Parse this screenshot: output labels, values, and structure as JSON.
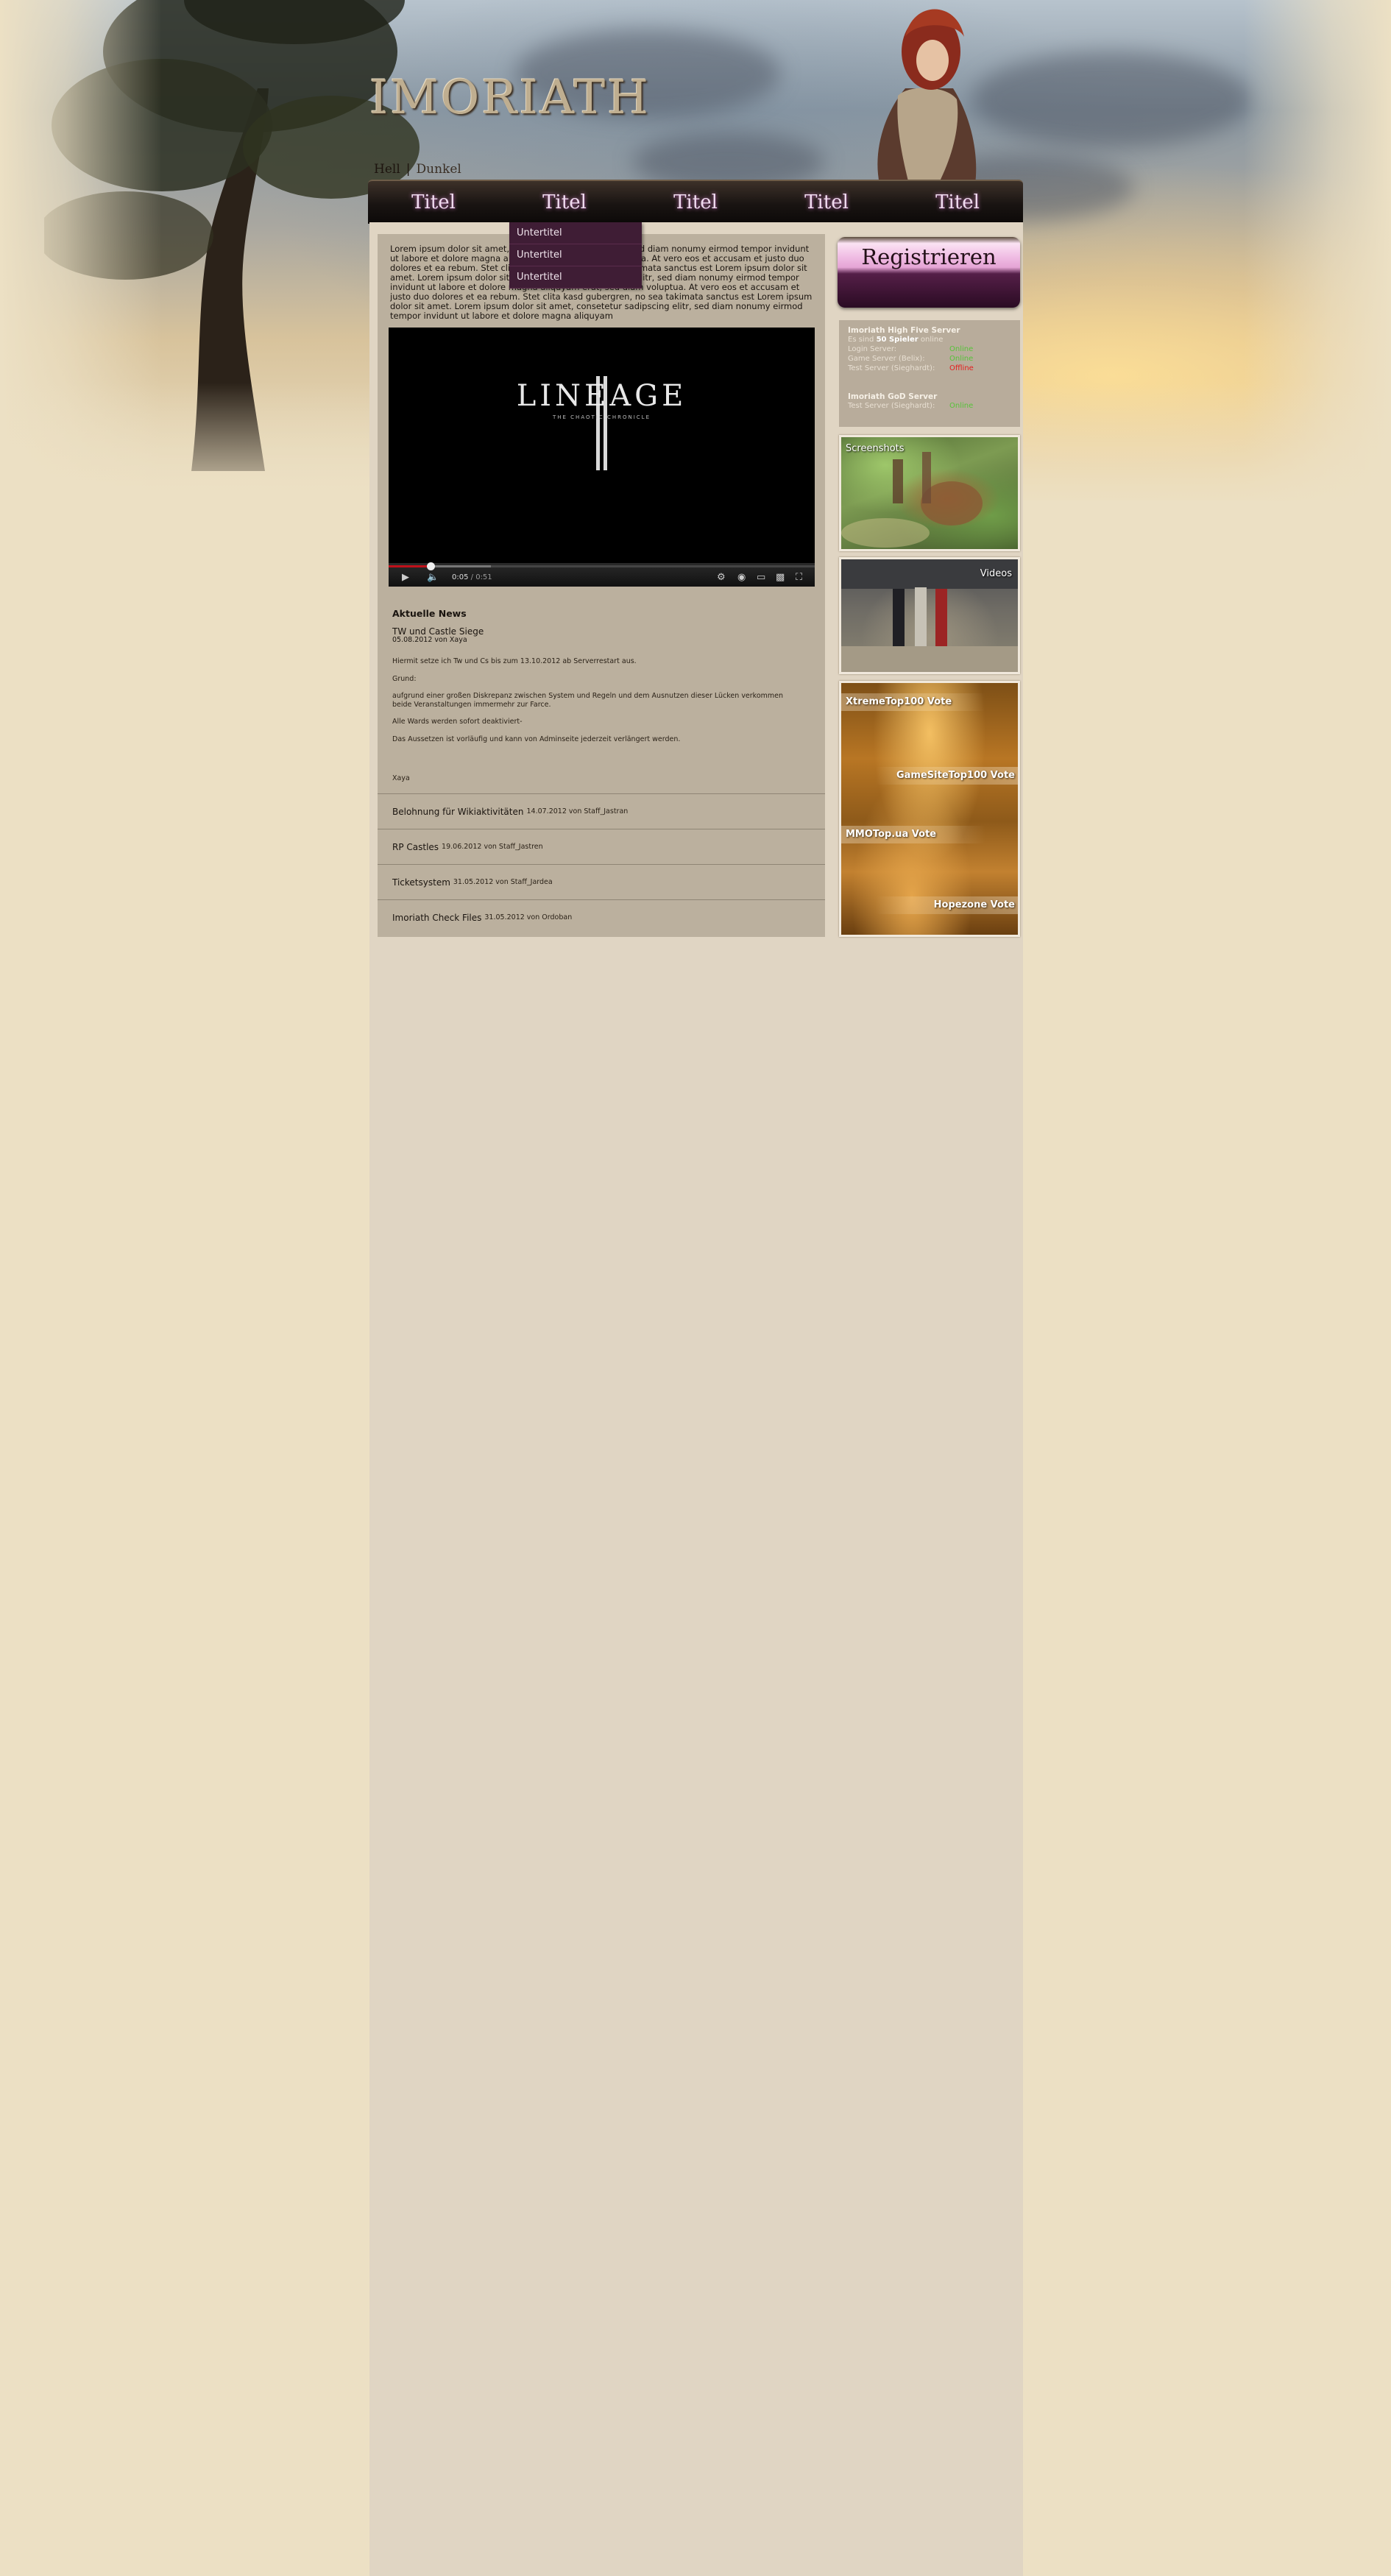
{
  "site": {
    "logo_text": "IMORIATH",
    "styles": {
      "hell": "Hell",
      "separator": "|",
      "dunkel": "Dunkel"
    }
  },
  "nav": {
    "items": [
      "Titel",
      "Titel",
      "Titel",
      "Titel",
      "Titel"
    ],
    "dropdown": [
      "Untertitel",
      "Untertitel",
      "Untertitel"
    ]
  },
  "intro_text": "Lorem ipsum dolor sit amet, consetetur sadipscing elitr, sed diam nonumy eirmod tempor invidunt ut labore et dolore magna aliquyam erat, sed diam voluptua. At vero eos et accusam et justo duo dolores et ea rebum. Stet clita kasd gubergren, no sea takimata sanctus est Lorem ipsum dolor sit amet. Lorem ipsum dolor sit amet, consetetur sadipscing elitr, sed diam nonumy eirmod tempor invidunt ut labore et dolore magna aliquyam erat, sed diam voluptua. At vero eos et accusam et justo duo dolores et ea rebum. Stet clita kasd gubergren, no sea takimata sanctus est Lorem ipsum dolor sit amet. Lorem ipsum dolor sit amet, consetetur sadipscing elitr, sed diam nonumy eirmod tempor invidunt ut labore et dolore magna aliquyam",
  "video": {
    "logo_text": "LINEAGE",
    "logo_subtitle": "THE CHAOTIC CHRONICLE",
    "time_current": "0:05",
    "time_duration": "/ 0:51",
    "played_fraction": 0.098,
    "buffered_fraction": 0.24
  },
  "news": {
    "heading": "Aktuelle News",
    "featured": {
      "title": "TW und Castle Siege",
      "meta": "05.08.2012 von Xaya",
      "paragraphs": [
        "Hiermit setze ich Tw und Cs bis zum 13.10.2012 ab Serverrestart aus.",
        "Grund:",
        "aufgrund einer großen Diskrepanz zwischen System und Regeln und dem Ausnutzen dieser Lücken verkommen beide Veranstaltungen immermehr zur Farce.",
        "Alle Wards werden sofort deaktiviert-",
        "Das Aussetzen ist vorläufig und kann von Adminseite jederzeit verlängert werden."
      ],
      "author": "Xaya"
    },
    "items": [
      {
        "title": "Belohnung für Wikiaktivitäten",
        "meta": "14.07.2012 von Staff_Jastran"
      },
      {
        "title": "RP Castles",
        "meta": "19.06.2012 von Staff_Jastren"
      },
      {
        "title": "Ticketsystem",
        "meta": "31.05.2012 von Staff_Jardea"
      },
      {
        "title": "Imoriath Check Files",
        "meta": "31.05.2012 von Ordoban"
      }
    ]
  },
  "sidebar": {
    "register_label": "Registrieren",
    "status": {
      "server1_title": "Imoriath High Five Server",
      "online_prefix": "Es sind",
      "online_count": "50 Spieler",
      "online_suffix": "online",
      "login_server": "Login Server:",
      "game_server": "Game Server (Belix):",
      "test_server1": "Test Server (Sieghardt):",
      "login_status": "Online",
      "game_status": "Online",
      "test1_status": "Offline",
      "server2_title": "Imoriath GoD Server",
      "test_server2": "Test Server (Sieghardt):",
      "test2_status": "Online"
    },
    "screenshots_label": "Screenshots",
    "videos_label": "Videos",
    "votes": [
      "XtremeTop100 Vote",
      "GameSiteTop100 Vote",
      "MMOTop.ua Vote",
      "Hopezone Vote"
    ]
  },
  "colors": {
    "accent_pink": "#f0bde4",
    "nav_dark": "#191412",
    "online": "#57c33a",
    "offline": "#e51d1d"
  }
}
